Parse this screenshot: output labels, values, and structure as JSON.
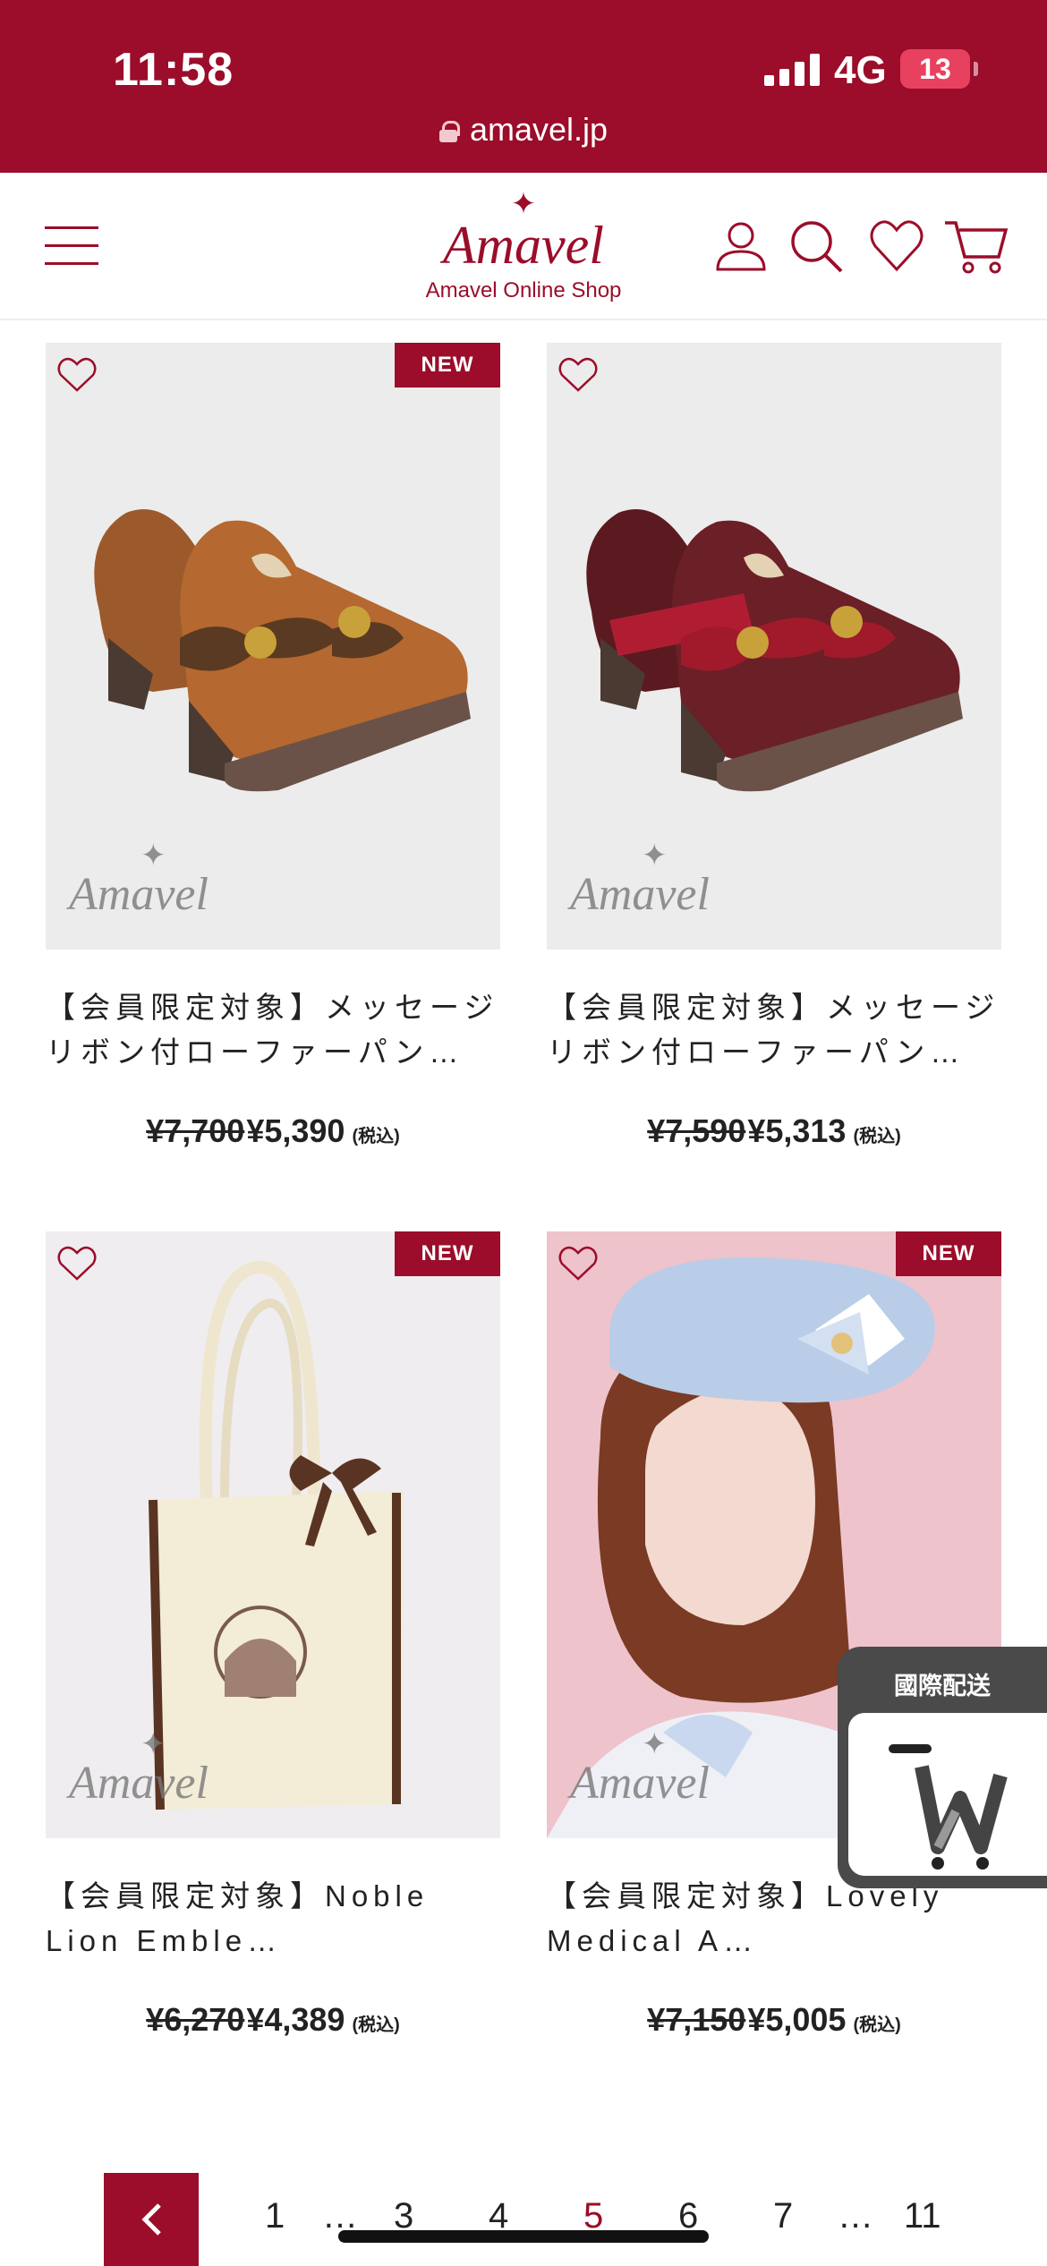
{
  "status_bar": {
    "time": "11:58",
    "network": "4G",
    "battery": "13"
  },
  "browser": {
    "url": "amavel.jp"
  },
  "header": {
    "logo_star": "✦",
    "logo_text": "Amavel",
    "logo_sub": "Amavel Online Shop"
  },
  "products": [
    {
      "badge": "NEW",
      "watermark": "Amavel",
      "name": "【会員限定対象】メッセージリボン付ローファーパン…",
      "old_price": "¥7,700",
      "price": "¥5,390",
      "tax": "(税込)"
    },
    {
      "badge": "",
      "watermark": "Amavel",
      "name": "【会員限定対象】メッセージリボン付ローファーパン…",
      "old_price": "¥7,590",
      "price": "¥5,313",
      "tax": "(税込)"
    },
    {
      "badge": "NEW",
      "watermark": "Amavel",
      "name": "【会員限定対象】Noble Lion Emble…",
      "old_price": "¥6,270",
      "price": "¥4,389",
      "tax": "(税込)"
    },
    {
      "badge": "NEW",
      "watermark": "Amavel",
      "name": "【会員限定対象】Lovely Medical A…",
      "old_price": "¥7,150",
      "price": "¥5,005",
      "tax": "(税込)"
    }
  ],
  "pagination": {
    "pages": [
      "1",
      "…",
      "3",
      "4",
      "5",
      "6",
      "7",
      "…",
      "11"
    ],
    "current": "5"
  },
  "intl_shipping": {
    "label": "國際配送"
  },
  "colors": {
    "brand": "#9b0d2a"
  }
}
